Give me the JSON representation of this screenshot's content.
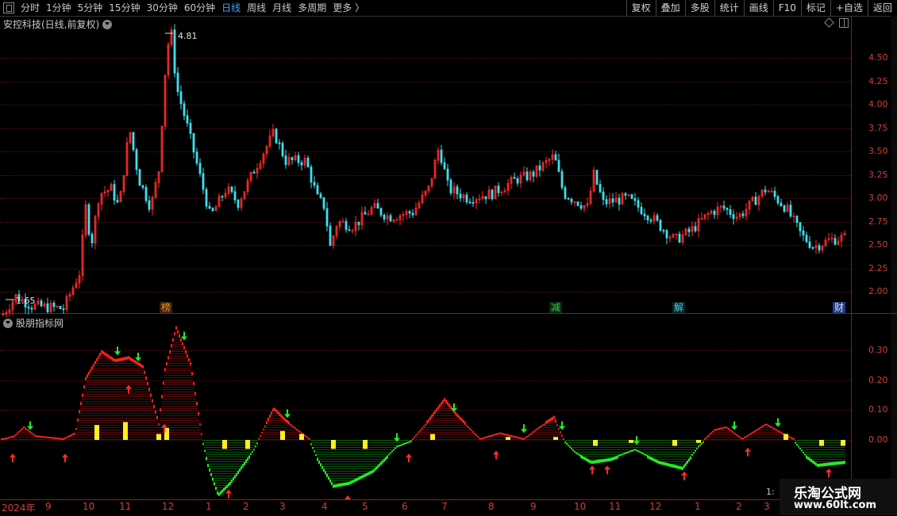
{
  "toolbar": {
    "periods": [
      "分时",
      "1分钟",
      "5分钟",
      "15分钟",
      "30分钟",
      "60分钟",
      "日线",
      "周线",
      "月线",
      "多周期",
      "更多 〉"
    ],
    "active_period": "日线",
    "buttons": [
      "复权",
      "叠加",
      "多股",
      "统计",
      "画线",
      "F10",
      "标记",
      "+自选",
      "返回"
    ]
  },
  "stock": {
    "title": "安控科技(日线,前复权)"
  },
  "indicator": {
    "title": "股朋指标网"
  },
  "price_axis": {
    "ticks": [
      "4.50",
      "4.25",
      "4.00",
      "3.75",
      "3.50",
      "3.25",
      "3.00",
      "2.75",
      "2.50",
      "2.25",
      "2.00"
    ]
  },
  "indicator_axis": {
    "ticks": [
      "0.30",
      "0.20",
      "0.10",
      "0.00"
    ]
  },
  "annotations": {
    "high": "4.81",
    "low": "1.65"
  },
  "badges": [
    {
      "text": "榜",
      "color": "#ff8c1a",
      "bg": "#3a2410"
    },
    {
      "text": "减",
      "color": "#2ecc40",
      "bg": "#0d260d"
    },
    {
      "text": "解",
      "color": "#3fd0e0",
      "bg": "#0d2428"
    },
    {
      "text": "财",
      "color": "#e0e0e0",
      "bg": "#1f3c8c"
    }
  ],
  "time_axis": {
    "labels": [
      "2024年",
      "9",
      "10",
      "11",
      "12",
      "1",
      "2",
      "3",
      "4",
      "5",
      "6",
      "7",
      "8",
      "9",
      "10",
      "11",
      "12",
      "1",
      "2",
      "3"
    ]
  },
  "watermark": {
    "line1": "乐淘公式网",
    "line2": "www.60lt.com"
  },
  "corner_label": "1:",
  "colors": {
    "up": "#ff2a2a",
    "down": "#3fe0f0",
    "ind_pos": "#ff2020",
    "ind_neg": "#22ee22",
    "bar_yellow": "#ffee22",
    "axis": "#d23c3c"
  },
  "chart_data": [
    {
      "type": "candlestick",
      "title": "安控科技(日线,前复权)",
      "ylim": [
        1.6,
        4.9
      ],
      "x": [
        "2024-08",
        "2024-09",
        "2024-10",
        "2024-11",
        "2024-12",
        "2025-01",
        "2025-02",
        "2025-03",
        "2025-04",
        "2025-05",
        "2025-06",
        "2025-07",
        "2025-08",
        "2025-09",
        "2025-10",
        "2025-11",
        "2025-12",
        "2026-01",
        "2026-02",
        "2026-03"
      ],
      "series": [
        {
          "values": [
            1.8,
            1.75,
            3.0,
            3.1,
            4.1,
            3.0,
            3.1,
            3.5,
            3.3,
            2.7,
            2.8,
            3.5,
            3.05,
            3.3,
            3.0,
            2.95,
            2.6,
            2.75,
            2.95,
            2.55
          ]
        }
      ],
      "high": 4.81,
      "low": 1.65
    },
    {
      "type": "area",
      "title": "股朋指标网",
      "ylim": [
        -0.2,
        0.38
      ],
      "series": [
        {
          "values": [
            0.0,
            0.04,
            0.0,
            0.25,
            0.27,
            0.33,
            -0.18,
            0.08,
            -0.16,
            -0.02,
            0.1,
            0.02,
            0.04,
            -0.06,
            -0.03,
            -0.08,
            0.03,
            0.03,
            -0.06,
            -0.06
          ]
        }
      ]
    }
  ]
}
